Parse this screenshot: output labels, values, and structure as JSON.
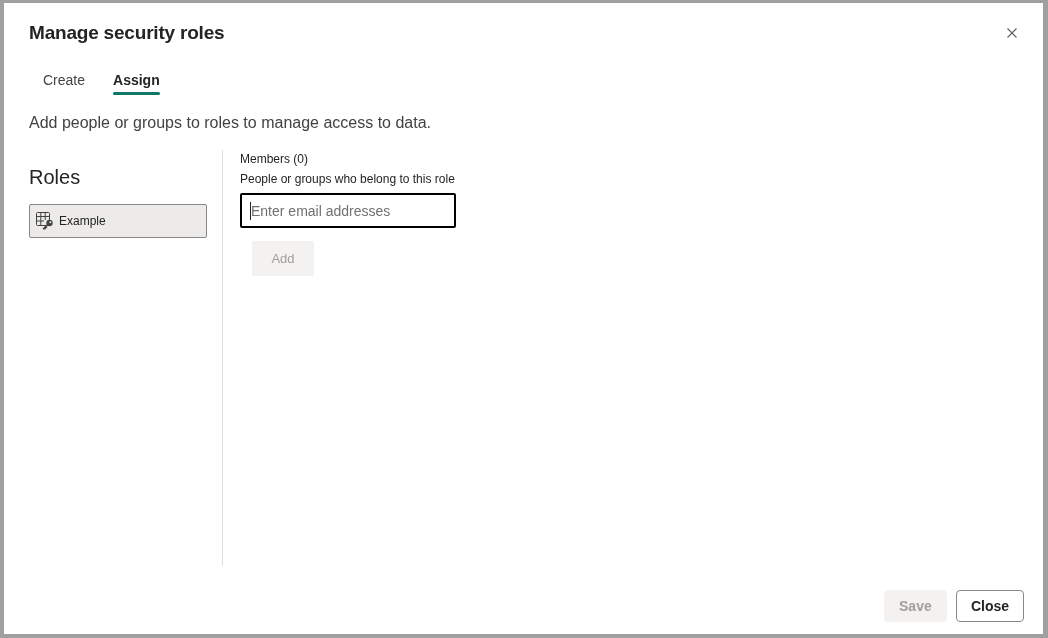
{
  "dialog": {
    "title": "Manage security roles"
  },
  "tabs": [
    {
      "label": "Create",
      "selected": false
    },
    {
      "label": "Assign",
      "selected": true
    }
  ],
  "description": "Add people or groups to roles to manage access to data.",
  "roles_panel": {
    "heading": "Roles",
    "items": [
      {
        "label": "Example",
        "selected": true
      }
    ]
  },
  "members": {
    "heading": "Members (0)",
    "hint": "People or groups who belong to this role",
    "input": {
      "placeholder": "Enter email addresses",
      "focused": true
    },
    "add_button": {
      "label": "Add",
      "disabled": true
    }
  },
  "footer": {
    "buttons": [
      {
        "label": "Save",
        "kind": "primary",
        "disabled": true
      },
      {
        "label": "Close",
        "kind": "default",
        "disabled": false
      }
    ]
  }
}
